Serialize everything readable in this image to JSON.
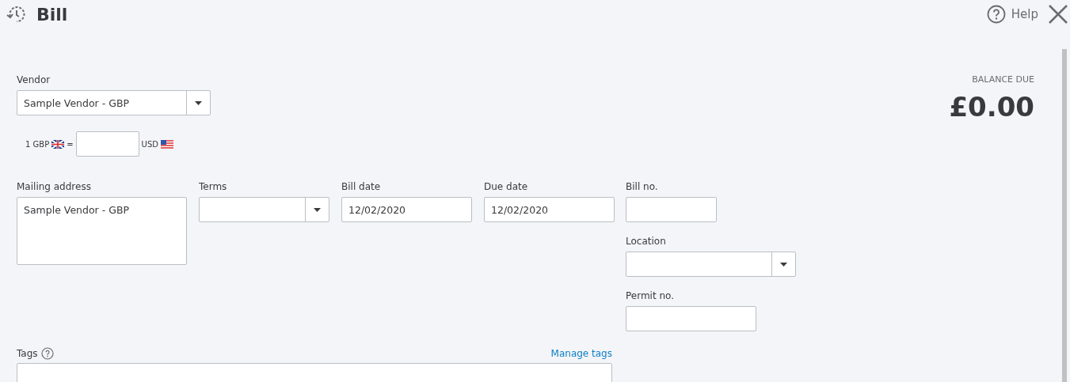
{
  "header": {
    "title": "Bill",
    "help": "Help"
  },
  "vendor": {
    "label": "Vendor",
    "value": "Sample Vendor - GBP"
  },
  "exchange": {
    "from": "1 GBP",
    "equals": "=",
    "to": "USD"
  },
  "balance": {
    "label": "BALANCE DUE",
    "amount": "£0.00"
  },
  "fields": [
    {
      "kind": "textarea",
      "label": "Mailing address",
      "value": "Sample Vendor - GBP"
    },
    {
      "kind": "dropdown",
      "label": "Terms"
    },
    {
      "kind": "text",
      "label": "Bill date",
      "value": "12/02/2020"
    },
    {
      "kind": "text",
      "label": "Due date",
      "value": "12/02/2020"
    }
  ],
  "side_fields": [
    {
      "kind": "text",
      "label": "Bill no."
    },
    {
      "kind": "dropdown",
      "label": "Location"
    },
    {
      "kind": "text",
      "label": "Permit no."
    }
  ],
  "tags": {
    "label": "Tags",
    "link": "Manage tags"
  }
}
